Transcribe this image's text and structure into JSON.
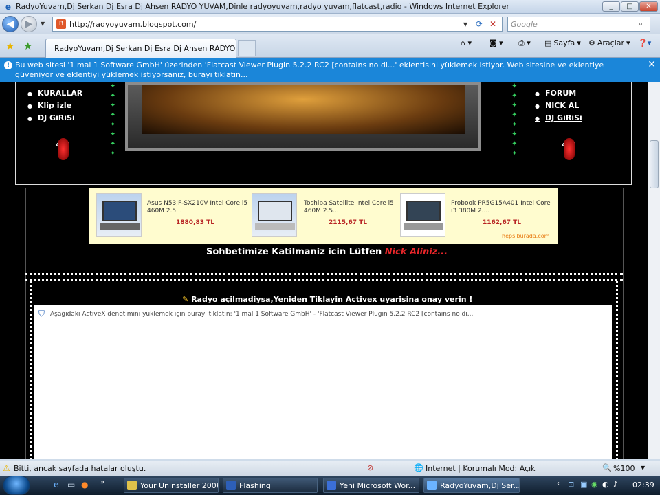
{
  "window": {
    "title": "RadyoYuvam,Dj Serkan Dj Esra Dj Ahsen RADYO YUVAM,Dinle radyoyuvam,radyo yuvam,flatcast,radio - Windows Internet Explorer",
    "minimize_glyph": "_",
    "maximize_glyph": "□",
    "close_glyph": "✕"
  },
  "address_bar": {
    "url": "http://radyoyuvam.blogspot.com/",
    "search_placeholder": "Google"
  },
  "tab": {
    "label": "RadyoYuvam,Dj Serkan Dj Esra Dj Ahsen RADYO ..."
  },
  "command_bar": {
    "page_label": "Sayfa",
    "tools_label": "Araçlar"
  },
  "infobar": {
    "text": "Bu web sitesi '1 mal 1 Software GmbH' üzerinden 'Flatcast Viewer Plugin 5.2.2 RC2 [contains no di...' eklentisini yüklemek istiyor. Web sitesine ve eklentiye güveniyor ve eklentiyi yüklemek istiyorsanız, burayı tıklatın..."
  },
  "page": {
    "left_menu": [
      "KURALLAR",
      "Klip izle",
      "DJ GiRiSi"
    ],
    "right_menu": [
      "FORUM",
      "NICK AL",
      "DJ GiRiSi"
    ],
    "ads": [
      {
        "name": "Asus N53JF-SX210V Intel Core i5 460M 2.5...",
        "price": "1880,83 TL"
      },
      {
        "name": "Toshiba Satellite Intel Core i5 460M 2.5...",
        "price": "2115,67 TL"
      },
      {
        "name": "Probook PR5G15A401 Intel Core i3 380M 2....",
        "price": "1162,67 TL"
      }
    ],
    "ad_brand": "hepsiburada.com",
    "sohbet_text": "Sohbetimize Katilmaniz icin Lütfen",
    "sohbet_link": "Nick Aliniz...",
    "radyo_text": "Radyo açilmadiysa,Yeniden Tiklayin Activex uyarisina onay verin !",
    "activex_text": "Aşağıdaki ActiveX denetimini yüklemek için burayı tıklatın: '1 mal 1 Software GmbH' - 'Flatcast Viewer Plugin 5.2.2 RC2 [contains no di...'"
  },
  "statusbar": {
    "left_text": "Bitti, ancak sayfada hatalar oluştu.",
    "zone_text": "Internet | Korumalı Mod: Açık",
    "zoom": "%100"
  },
  "taskbar": {
    "tasks": [
      {
        "label": "Your Uninstaller 2006",
        "active": false
      },
      {
        "label": "Flashing",
        "active": false
      },
      {
        "label": "Yeni Microsoft Wor...",
        "active": false
      },
      {
        "label": "RadyoYuvam,Dj Ser...",
        "active": true
      }
    ],
    "clock": "02:39"
  }
}
